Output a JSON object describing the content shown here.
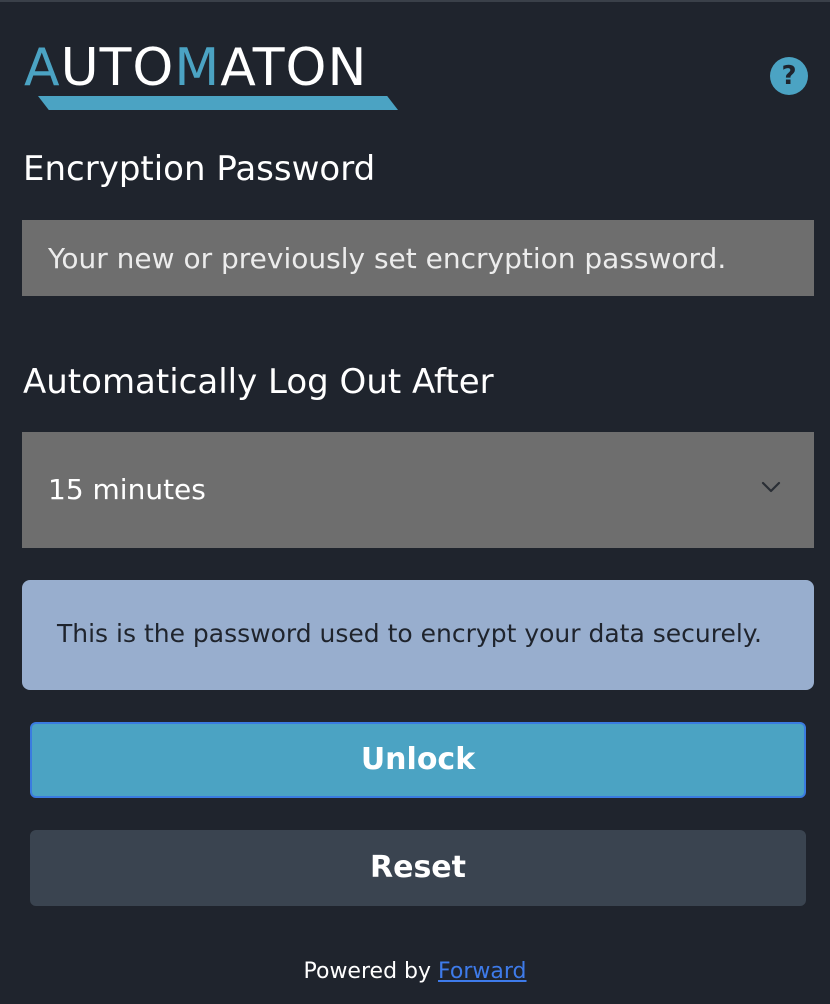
{
  "logo": {
    "parts": [
      {
        "text": "A",
        "accent": true
      },
      {
        "text": "UTO",
        "accent": false
      },
      {
        "text": "M",
        "accent": true
      },
      {
        "text": "ATON",
        "accent": false
      }
    ]
  },
  "help": {
    "icon": "question-circle-icon",
    "glyph": "?"
  },
  "password_section": {
    "label": "Encryption Password",
    "placeholder": "Your new or previously set encryption password.",
    "value": ""
  },
  "logout_section": {
    "label": "Automatically Log Out After",
    "selected": "15 minutes",
    "icon": "chevron-down-icon"
  },
  "info": {
    "text": "This is the password used to encrypt your data securely."
  },
  "buttons": {
    "unlock": "Unlock",
    "reset": "Reset"
  },
  "footer": {
    "prefix": "Powered by",
    "link_text": "Forward"
  },
  "colors": {
    "background": "#1f242d",
    "accent": "#4ba3c3",
    "input_bg": "#6e6e6e",
    "info_bg": "#98aece",
    "reset_bg": "#3a4450",
    "link": "#3e7bea",
    "focus_border": "#3a7be0"
  }
}
